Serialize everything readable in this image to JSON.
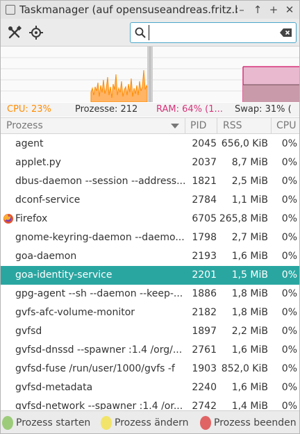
{
  "window": {
    "title": "Taskmanager (auf opensuseandreas.fritz.bo",
    "buttons": {
      "minimize": "–",
      "up": "↑",
      "maximize": "+",
      "close": "✕"
    }
  },
  "toolbar": {
    "settings_icon": "tools-icon",
    "target_icon": "crosshair-icon",
    "search": {
      "value": "",
      "placeholder": ""
    }
  },
  "colors": {
    "cpu": "#ff8c00",
    "ram": "#d6337a",
    "selection": "#2aa6a1",
    "start": "#9ccc7a",
    "change": "#f2e46a",
    "end": "#e06464"
  },
  "status": {
    "cpu": "CPU: 23%",
    "processes": "Prozesse: 212",
    "ram": "RAM: 64% (1...",
    "swap": "Swap: 31% ("
  },
  "table": {
    "headers": {
      "name": "Prozess",
      "pid": "PID",
      "rss": "RSS",
      "cpu": "CPU"
    },
    "rows": [
      {
        "name": "agent",
        "pid": "2045",
        "rss": "656,0 KiB",
        "cpu": "0%"
      },
      {
        "name": "applet.py",
        "pid": "2037",
        "rss": "8,7 MiB",
        "cpu": "0%"
      },
      {
        "name": "dbus-daemon --session --address...",
        "pid": "1821",
        "rss": "2,5 MiB",
        "cpu": "0%"
      },
      {
        "name": "dconf-service",
        "pid": "2784",
        "rss": "1,1 MiB",
        "cpu": "0%"
      },
      {
        "name": "Firefox",
        "pid": "6705",
        "rss": "265,8 MiB",
        "cpu": "0%",
        "icon": "firefox-icon"
      },
      {
        "name": "gnome-keyring-daemon --daemo...",
        "pid": "1798",
        "rss": "2,7 MiB",
        "cpu": "0%"
      },
      {
        "name": "goa-daemon",
        "pid": "2193",
        "rss": "1,6 MiB",
        "cpu": "0%"
      },
      {
        "name": "goa-identity-service",
        "pid": "2201",
        "rss": "1,5 MiB",
        "cpu": "0%",
        "selected": true
      },
      {
        "name": "gpg-agent --sh --daemon --keep-...",
        "pid": "1886",
        "rss": "1,8 MiB",
        "cpu": "0%"
      },
      {
        "name": "gvfs-afc-volume-monitor",
        "pid": "2182",
        "rss": "1,8 MiB",
        "cpu": "0%"
      },
      {
        "name": "gvfsd",
        "pid": "1897",
        "rss": "2,2 MiB",
        "cpu": "0%"
      },
      {
        "name": "gvfsd-dnssd --spawner :1.4 /org/...",
        "pid": "2761",
        "rss": "1,6 MiB",
        "cpu": "0%"
      },
      {
        "name": "gvfsd-fuse /run/user/1000/gvfs -f",
        "pid": "1903",
        "rss": "852,0 KiB",
        "cpu": "0%"
      },
      {
        "name": "gvfsd-metadata",
        "pid": "2240",
        "rss": "1,6 MiB",
        "cpu": "0%"
      },
      {
        "name": "gvfsd-network --spawner :1.4 /or...",
        "pid": "2742",
        "rss": "1,4 MiB",
        "cpu": "0%"
      }
    ]
  },
  "actions": {
    "start": "Prozess starten",
    "change": "Prozess ändern",
    "end": "Prozess beenden"
  }
}
